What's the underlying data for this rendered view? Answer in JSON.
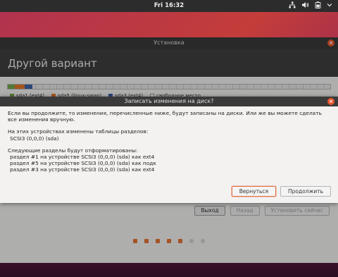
{
  "topbar": {
    "clock": "Fri 16:32"
  },
  "installer": {
    "window_title": "Установка",
    "header": "Другой вариант",
    "legend": [
      {
        "label": "sda1 (ext4)",
        "color": "#73a74a"
      },
      {
        "label": "sda5 (linux-swap)",
        "color": "#e3772c"
      },
      {
        "label": "sda3 (ext4)",
        "color": "#3c63a8"
      },
      {
        "label": "свободное место",
        "color": "#ffffff"
      }
    ],
    "buttons": {
      "quit": "Выход",
      "back": "Назад",
      "install": "Установить сейчас"
    }
  },
  "dialog": {
    "title": "Записать изменения на диск?",
    "intro": "Если вы продолжите, то изменения, перечисленные ниже, будут записаны на диски. Или же вы можете сделать все изменения вручную.",
    "tables_heading": "На этих устройствах изменены таблицы разделов:",
    "tables_device": "SCSI3 (0,0,0) (sda)",
    "format_heading": "Следующие разделы будут отформатированы:",
    "format_items": [
      "раздел #1 на устройстве SCSI3 (0,0,0) (sda) как ext4",
      "раздел #5 на устройстве SCSI3 (0,0,0) (sda) как подк",
      "раздел #3 на устройстве SCSI3 (0,0,0) (sda) как ext4"
    ],
    "back_button": "Вернуться",
    "continue_button": "Продолжить"
  },
  "progress": {
    "total_steps": 7,
    "completed_steps": 5
  }
}
